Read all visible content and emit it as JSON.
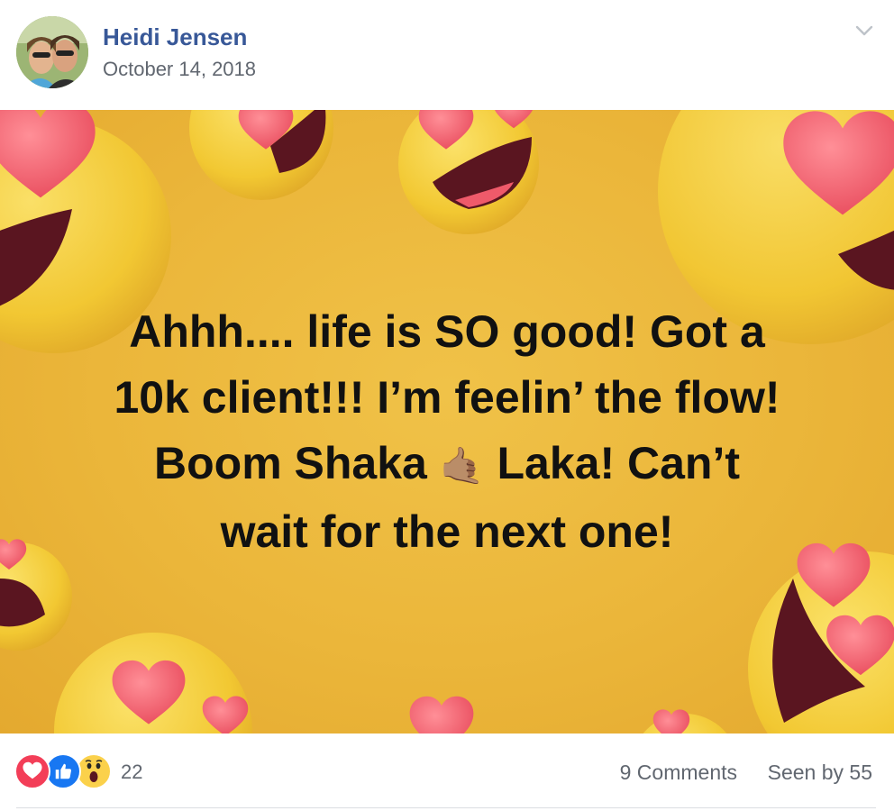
{
  "post": {
    "author": "Heidi Jensen",
    "date": "October 14, 2018",
    "menu_icon": "chevron-down-icon",
    "text_lines": [
      "Ahhh.... life is SO good! Got a",
      "10k client!!! I’m feelin’ the flow!",
      "Boom Shaka",
      "Laka! Can’t",
      "wait for the next one!"
    ],
    "emoji": "🤙🏽",
    "background": {
      "base_color": "#EBB63A",
      "emoji_face_color": "#F5CF3A",
      "heart_color": "#EF5A6A",
      "mouth_color": "#5A1520"
    }
  },
  "footer": {
    "reaction_icons": [
      "love-reaction-icon",
      "like-reaction-icon",
      "wow-reaction-icon"
    ],
    "reaction_count": "22",
    "comments": "9 Comments",
    "seen": "Seen by 55"
  },
  "colors": {
    "author_link": "#385898",
    "meta_text": "#616770",
    "love": "#F33E58",
    "like": "#1877F2",
    "wow": "#FBD14B"
  }
}
